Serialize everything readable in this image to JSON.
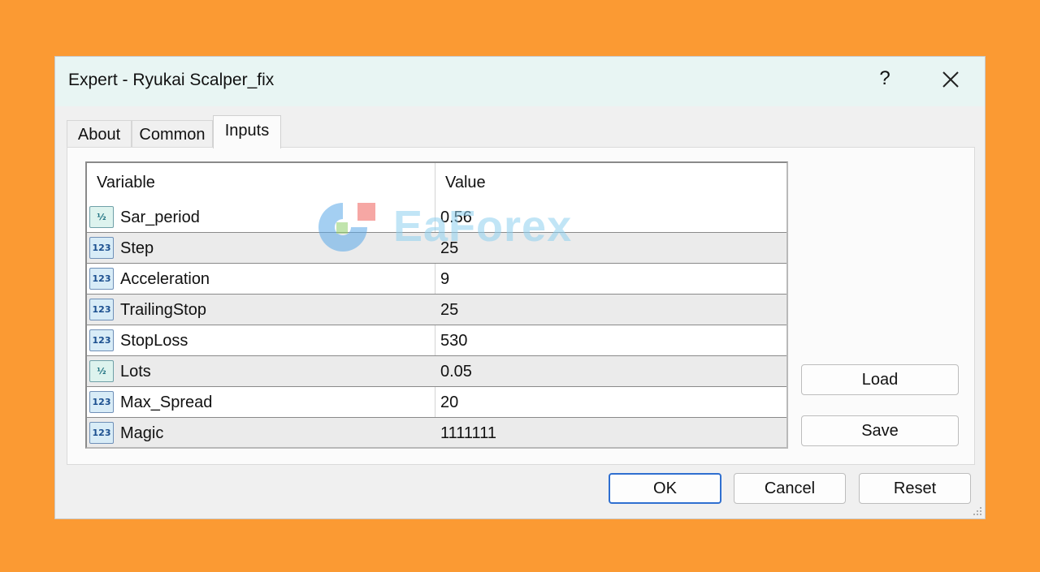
{
  "window": {
    "title": "Expert - Ryukai Scalper_fix",
    "help_label": "?"
  },
  "tabs": [
    {
      "label": "About"
    },
    {
      "label": "Common"
    },
    {
      "label": "Inputs",
      "active": true
    }
  ],
  "grid": {
    "headers": {
      "variable": "Variable",
      "value": "Value"
    },
    "rows": [
      {
        "icon": "fraction-icon",
        "icon_text": "½",
        "name": "Sar_period",
        "value": "0.56"
      },
      {
        "icon": "integer-icon",
        "icon_text": "123",
        "name": "Step",
        "value": "25"
      },
      {
        "icon": "integer-icon",
        "icon_text": "123",
        "name": "Acceleration",
        "value": "9"
      },
      {
        "icon": "integer-icon",
        "icon_text": "123",
        "name": "TrailingStop",
        "value": "25"
      },
      {
        "icon": "integer-icon",
        "icon_text": "123",
        "name": "StopLoss",
        "value": "530"
      },
      {
        "icon": "fraction-icon",
        "icon_text": "½",
        "name": "Lots",
        "value": "0.05"
      },
      {
        "icon": "integer-icon",
        "icon_text": "123",
        "name": "Max_Spread",
        "value": "20"
      },
      {
        "icon": "integer-icon",
        "icon_text": "123",
        "name": "Magic",
        "value": "1111111"
      }
    ]
  },
  "side_buttons": {
    "load": "Load",
    "save": "Save"
  },
  "footer_buttons": {
    "ok": "OK",
    "cancel": "Cancel",
    "reset": "Reset"
  },
  "watermark": {
    "text": "EaForex"
  },
  "colors": {
    "background": "#fb9a33",
    "titlebar": "#e8f5f3",
    "accent": "#2f6fd0"
  }
}
